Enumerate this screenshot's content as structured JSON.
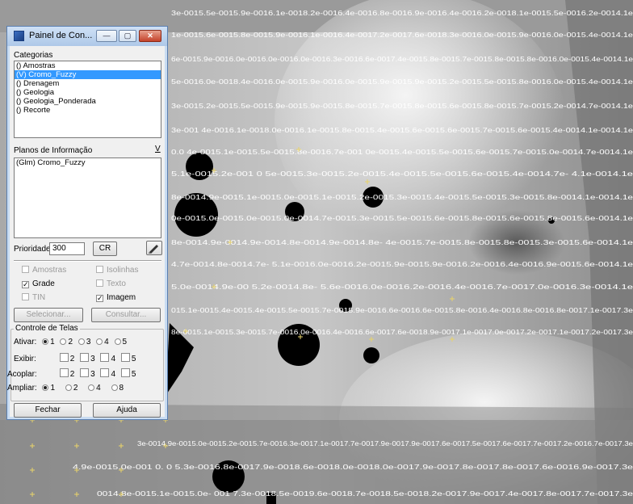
{
  "window": {
    "title": "Painel de Con...",
    "buttons": {
      "minimize": "—",
      "maximize": "▢",
      "close": "✕"
    }
  },
  "categorias": {
    "label": "Categorias",
    "items": [
      "() Amostras",
      "(V) Cromo_Fuzzy",
      "() Drenagem",
      "() Geologia",
      "() Geologia_Ponderada",
      "() Recorte"
    ],
    "selected_index": 1
  },
  "planos": {
    "label": "Planos de Informação",
    "toggle": "V",
    "items": [
      "(Glm) Cromo_Fuzzy"
    ]
  },
  "prioridade": {
    "label": "Prioridade:",
    "value": "300",
    "cr_button": "CR"
  },
  "display_options": {
    "amostras": {
      "label": "Amostras",
      "checked": false,
      "enabled": false
    },
    "isolinhas": {
      "label": "Isolinhas",
      "checked": false,
      "enabled": false
    },
    "grade": {
      "label": "Grade",
      "checked": true,
      "enabled": true
    },
    "texto": {
      "label": "Texto",
      "checked": false,
      "enabled": false
    },
    "tin": {
      "label": "TIN",
      "checked": false,
      "enabled": false
    },
    "imagem": {
      "label": "Imagem",
      "checked": true,
      "enabled": true
    }
  },
  "actions": {
    "selecionar": "Selecionar...",
    "consultar": "Consultar..."
  },
  "controle": {
    "title": "Controle de Telas",
    "ativar": {
      "label": "Ativar:",
      "options": [
        "1",
        "2",
        "3",
        "4",
        "5"
      ],
      "selected": "1"
    },
    "exibir": {
      "label": "Exibir:",
      "options": [
        "2",
        "3",
        "4",
        "5"
      ]
    },
    "acoplar": {
      "label": "Acoplar:",
      "options": [
        "2",
        "3",
        "4",
        "5"
      ]
    },
    "ampliar": {
      "label": "Ampliar:",
      "options": [
        "1",
        "2",
        "4",
        "8"
      ],
      "selected": "1"
    }
  },
  "footer": {
    "fechar": "Fechar",
    "ajuda": "Ajuda"
  },
  "map": {
    "rows": [
      "3e-0015.5e-0015.9e-0016.1e-0018.2e-0016.4e-0016.8e-0016.9e-0016.4e-0016.2e-0018.1e-0015.5e-0016.2e-0014.1e",
      "1e-0015.6e-0015.8e-0015.9e-0016.1e-0016.4e-0017.2e-0017.6e-0018.3e-0016.0e-0015.9e-0016.0e-0015.4e-0014.1e",
      "6e-0015.9e-0016.0e-0016.0e-0016.0e-0016.3e-0016.6e-0017.4e-0015.8e-0015.7e-0015.8e-0015.8e-0016.0e-0015.4e-0014.1e",
      "5e-0016.0e-0018.4e-0016.0e-0015.9e-0016.0e-0015.9e-0015.9e-0015.2e-0015.5e-0015.8e-0016.0e-0015.4e-0014.1e",
      "3e-0015.2e-0015.5e-0015.9e-0015.9e-0015.8e-0015.7e-0015.8e-0015.6e-0015.8e-0015.7e-0015.2e-0014.7e-0014.1e",
      "3e-001      4e-0016.1e-0018.0e-0016.1e-0015.8e-0015.4e-0015.6e-0015.6e-0015.7e-0015.6e-0015.4e-0014.1e-0014.1e",
      "0.0   4e-0015.1e-0015.5e-0015.8e-0016.7e-001   0e-0015.4e-0015.5e-0015.6e-0015.7e-0015.0e-0014.7e-0014.1e",
      "5.1e-0015.2e-001   0   5e-0015.3e-0015.2e-0015.4e-0015.5e-0015.6e-0015.4e-0014.7e-  4.1e-0014.1e",
      "8e-0014.9e-0015.1e-0015.0e-0015.1e-0015.2e-0015.3e-0015.4e-0015.5e-0015.3e-0015.8e-0014.1e-0014.1e",
      "0e-0015.0e-0015.0e-0015.0e-0014.7e-0015.3e-0015.5e-0015.6e-0015.8e-0015.6e-0015.8e-0015.6e-0014.1e",
      "8e-0014.9e-0014.9e-0014.8e-0014.9e-0014.8e-  4e-0015.7e-0015.8e-0015.8e-0015.3e-0015.6e-0014.1e",
      "4.7e-0014.8e-0014.7e-          5.1e-0016.0e-0016.2e-0015.9e-0015.9e-0016.2e-0016.4e-0016.9e-0015.6e-0014.1e",
      "5.0e-0014.9e-00    5.2e-0014.8e-  5.6e-0016.0e-0016.2e-0016.4e-0016.7e-0017.0e-0016.3e-0014.1e",
      "015.1e-0015.4e-0015.4e-0015.5e-0015.7e-0015.9e-0016.6e-0016.6e-0015.8e-0016.4e-0016.8e-0016.8e-0017.1e-0017.3e",
      "8e-0015.1e-0015.3e-0015.7e-0016.0e-0016.4e-0016.6e-0017.6e-0018.9e-0017.1e-0017.0e-0017.2e-0017.1e-0017.2e-0017.3e",
      "3e-0014.9e-0015.0e-0015.2e-0015.7e-0016.3e-0017.1e-0017.7e-0017.9e-0017.9e-0017.6e-0017.5e-0017.6e-0017.7e-0017.2e-0016.7e-0017.3e",
      "4.9e-0015.0e-001   0.   0   5.3e-0016.8e-0017.9e-0018.6e-0018.0e-0018.0e-0017.9e-0017.8e-0017.8e-0017.6e-0016.9e-0017.3e",
      "0014.8e-0015.1e-0015.0e-      001   7.3e-0018.5e-0019.6e-0018.7e-0018.5e-0018.2e-0017.9e-0017.4e-0017.8e-0017.7e-0017.3e"
    ]
  }
}
